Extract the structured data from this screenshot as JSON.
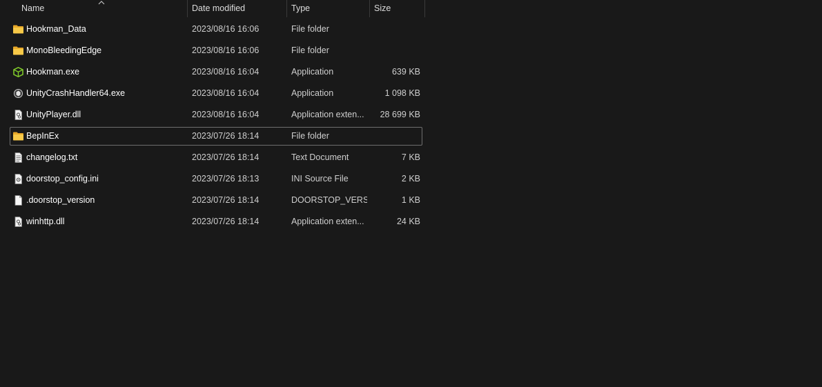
{
  "header": {
    "name_label": "Name",
    "date_label": "Date modified",
    "type_label": "Type",
    "size_label": "Size",
    "sort_icon": "chevron-up-icon"
  },
  "files": [
    {
      "name": "Hookman_Data",
      "date": "2023/08/16 16:06",
      "type": "File folder",
      "size": "",
      "icon": "folder-icon"
    },
    {
      "name": "MonoBleedingEdge",
      "date": "2023/08/16 16:06",
      "type": "File folder",
      "size": "",
      "icon": "folder-icon"
    },
    {
      "name": "Hookman.exe",
      "date": "2023/08/16 16:04",
      "type": "Application",
      "size": "639 KB",
      "icon": "app-cube-icon"
    },
    {
      "name": "UnityCrashHandler64.exe",
      "date": "2023/08/16 16:04",
      "type": "Application",
      "size": "1 098 KB",
      "icon": "unity-app-icon"
    },
    {
      "name": "UnityPlayer.dll",
      "date": "2023/08/16 16:04",
      "type": "Application exten...",
      "size": "28 699 KB",
      "icon": "dll-file-icon"
    },
    {
      "name": "BepInEx",
      "date": "2023/07/26 18:14",
      "type": "File folder",
      "size": "",
      "icon": "folder-icon"
    },
    {
      "name": "changelog.txt",
      "date": "2023/07/26 18:14",
      "type": "Text Document",
      "size": "7 KB",
      "icon": "text-file-icon"
    },
    {
      "name": "doorstop_config.ini",
      "date": "2023/07/26 18:13",
      "type": "INI Source File",
      "size": "2 KB",
      "icon": "config-file-icon"
    },
    {
      "name": ".doorstop_version",
      "date": "2023/07/26 18:14",
      "type": "DOORSTOP_VERSI...",
      "size": "1 KB",
      "icon": "blank-file-icon"
    },
    {
      "name": "winhttp.dll",
      "date": "2023/07/26 18:14",
      "type": "Application exten...",
      "size": "24 KB",
      "icon": "dll-file-icon"
    }
  ],
  "focused_row": 5,
  "colors": {
    "background": "#191919",
    "folder": "#f5c342",
    "app_green": "#7ec62a"
  }
}
